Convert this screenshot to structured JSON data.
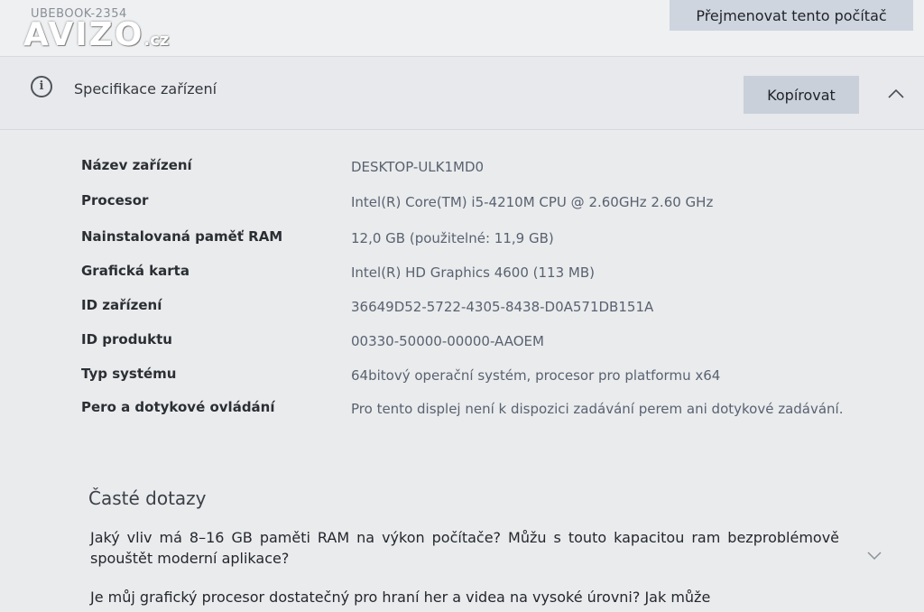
{
  "topbar": {
    "device_subtitle": "UBEBOOK-2354",
    "rename_button": "Přejmenovat tento počítač",
    "watermark": {
      "main": "AVIZO",
      "suffix": ".cz"
    }
  },
  "spec_header": {
    "icon": "info-icon",
    "title": "Specifikace zařízení",
    "copy_button": "Kopírovat",
    "collapse_icon": "chevron-up-icon"
  },
  "specs": [
    {
      "label": "Název zařízení",
      "value": "DESKTOP-ULK1MD0"
    },
    {
      "label": "Procesor",
      "value": "Intel(R) Core(TM) i5-4210M CPU @ 2.60GHz   2.60 GHz"
    },
    {
      "label": "Nainstalovaná paměť RAM",
      "value": "12,0 GB (použitelné: 11,9 GB)"
    },
    {
      "label": "Grafická karta",
      "value": "Intel(R) HD Graphics 4600 (113 MB)"
    },
    {
      "label": "ID zařízení",
      "value": "36649D52-5722-4305-8438-D0A571DB151A"
    },
    {
      "label": "ID produktu",
      "value": "00330-50000-00000-AAOEM"
    },
    {
      "label": "Typ systému",
      "value": "64bitový operační systém, procesor pro platformu x64"
    },
    {
      "label": "Pero a dotykové ovládání",
      "value": "Pro tento displej není k dispozici zadávání perem ani dotykové zadávání."
    }
  ],
  "faq": {
    "title": "Časté dotazy",
    "questions": [
      "Jaký vliv má 8–16 GB paměti RAM na výkon počítače? Můžu s touto kapacitou ram bezproblémově spouštět moderní aplikace?",
      "Je můj grafický procesor dostatečný pro hraní her a videa na vysoké úrovni? Jak může"
    ],
    "expand_icon": "chevron-down-icon"
  },
  "colors": {
    "background": "#e9ebed",
    "button": "#cfd5de",
    "value_text": "#5a6270"
  }
}
